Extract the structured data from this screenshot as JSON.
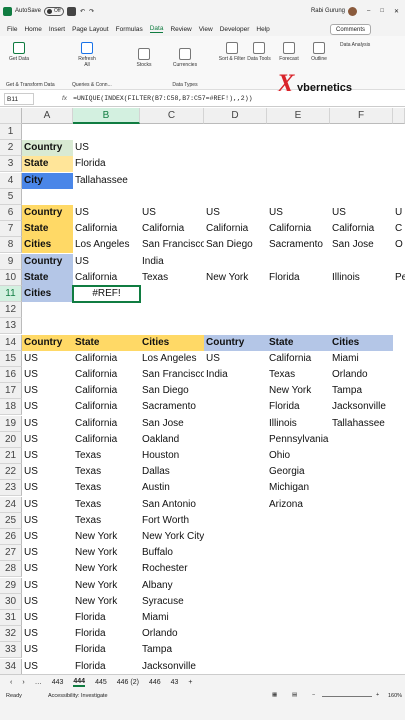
{
  "titlebar": {
    "autosave": "AutoSave",
    "toggle": "Off",
    "user": "Rabi Gurung"
  },
  "menu": [
    "File",
    "Home",
    "Insert",
    "Page Layout",
    "Formulas",
    "Data",
    "Review",
    "View",
    "Developer",
    "Help"
  ],
  "menu_active": "Data",
  "comments": "Comments",
  "ribbon": {
    "get_data": "Get Data",
    "refresh": "Refresh All",
    "stocks": "Stocks",
    "currencies": "Currencies",
    "sort_filter": "Sort & Filter",
    "data_tools": "Data Tools",
    "forecast": "Forecast",
    "outline": "Outline",
    "data_analysis": "Data Analysis",
    "group1": "Get & Transform Data",
    "group2": "Queries & Conn...",
    "group3": "Data Types"
  },
  "formula_bar": {
    "name_box": "B11",
    "formula": "=UNIQUE(INDEX(FILTER(B7:C58,B7:C57=#REF!),,2))"
  },
  "logo": {
    "x_glyph": "X",
    "text": "ybernetics"
  },
  "columns": [
    "A",
    "B",
    "C",
    "D",
    "E",
    "F"
  ],
  "rows": [
    "1",
    "2",
    "3",
    "4",
    "5",
    "6",
    "7",
    "8",
    "9",
    "10",
    "11",
    "12",
    "13",
    "14",
    "15",
    "16",
    "17",
    "18",
    "19",
    "20",
    "21",
    "22",
    "23",
    "24",
    "25",
    "26",
    "27",
    "28",
    "29",
    "30",
    "31",
    "32",
    "33",
    "34"
  ],
  "cells": {
    "r2": [
      "Country",
      "US"
    ],
    "r3": [
      "State",
      "Florida"
    ],
    "r4": [
      "City",
      "Tallahassee"
    ],
    "r6": [
      "Country",
      "US",
      "US",
      "US",
      "US",
      "US",
      "U"
    ],
    "r7": [
      "State",
      "California",
      "California",
      "California",
      "California",
      "California",
      "C"
    ],
    "r8": [
      "Cities",
      "Los Angeles",
      "San Francisco",
      "San Diego",
      "Sacramento",
      "San Jose",
      "O"
    ],
    "r9": [
      "Country",
      "US",
      "India"
    ],
    "r10": [
      "State",
      "California",
      "Texas",
      "New York",
      "Florida",
      "Illinois",
      "Pe"
    ],
    "r11": [
      "Cities",
      "#REF!"
    ],
    "r14": [
      "Country",
      "State",
      "Cities",
      "Country",
      "State",
      "Cities"
    ],
    "table_left": [
      [
        "US",
        "California",
        "Los Angeles"
      ],
      [
        "US",
        "California",
        "San Francisco"
      ],
      [
        "US",
        "California",
        "San Diego"
      ],
      [
        "US",
        "California",
        "Sacramento"
      ],
      [
        "US",
        "California",
        "San Jose"
      ],
      [
        "US",
        "California",
        "Oakland"
      ],
      [
        "US",
        "Texas",
        "Houston"
      ],
      [
        "US",
        "Texas",
        "Dallas"
      ],
      [
        "US",
        "Texas",
        "Austin"
      ],
      [
        "US",
        "Texas",
        "San Antonio"
      ],
      [
        "US",
        "Texas",
        "Fort Worth"
      ],
      [
        "US",
        "New York",
        "New York City"
      ],
      [
        "US",
        "New York",
        "Buffalo"
      ],
      [
        "US",
        "New York",
        "Rochester"
      ],
      [
        "US",
        "New York",
        "Albany"
      ],
      [
        "US",
        "New York",
        "Syracuse"
      ],
      [
        "US",
        "Florida",
        "Miami"
      ],
      [
        "US",
        "Florida",
        "Orlando"
      ],
      [
        "US",
        "Florida",
        "Tampa"
      ],
      [
        "US",
        "Florida",
        "Jacksonville"
      ]
    ],
    "table_right": [
      [
        "US",
        "California",
        "Miami"
      ],
      [
        "India",
        "Texas",
        "Orlando"
      ],
      [
        "",
        "New York",
        "Tampa"
      ],
      [
        "",
        "Florida",
        "Jacksonville"
      ],
      [
        "",
        "Illinois",
        "Tallahassee"
      ],
      [
        "",
        "Pennsylvania",
        ""
      ],
      [
        "",
        "Ohio",
        ""
      ],
      [
        "",
        "Georgia",
        ""
      ],
      [
        "",
        "Michigan",
        ""
      ],
      [
        "",
        "Arizona",
        ""
      ]
    ]
  },
  "sheets": [
    "443",
    "444",
    "445",
    "446 (2)",
    "446",
    "43"
  ],
  "sheet_active": "444",
  "status": {
    "ready": "Ready",
    "accessibility": "Accessibility: Investigate",
    "zoom": "160%"
  },
  "colors": {
    "green_hdr": "#d9ead3",
    "yellow_hdr": "#ffe599",
    "blue_hdr": "#4a86e8",
    "gold": "#ffd966",
    "lightblue": "#b4c6e7",
    "accent": "#107c41"
  }
}
